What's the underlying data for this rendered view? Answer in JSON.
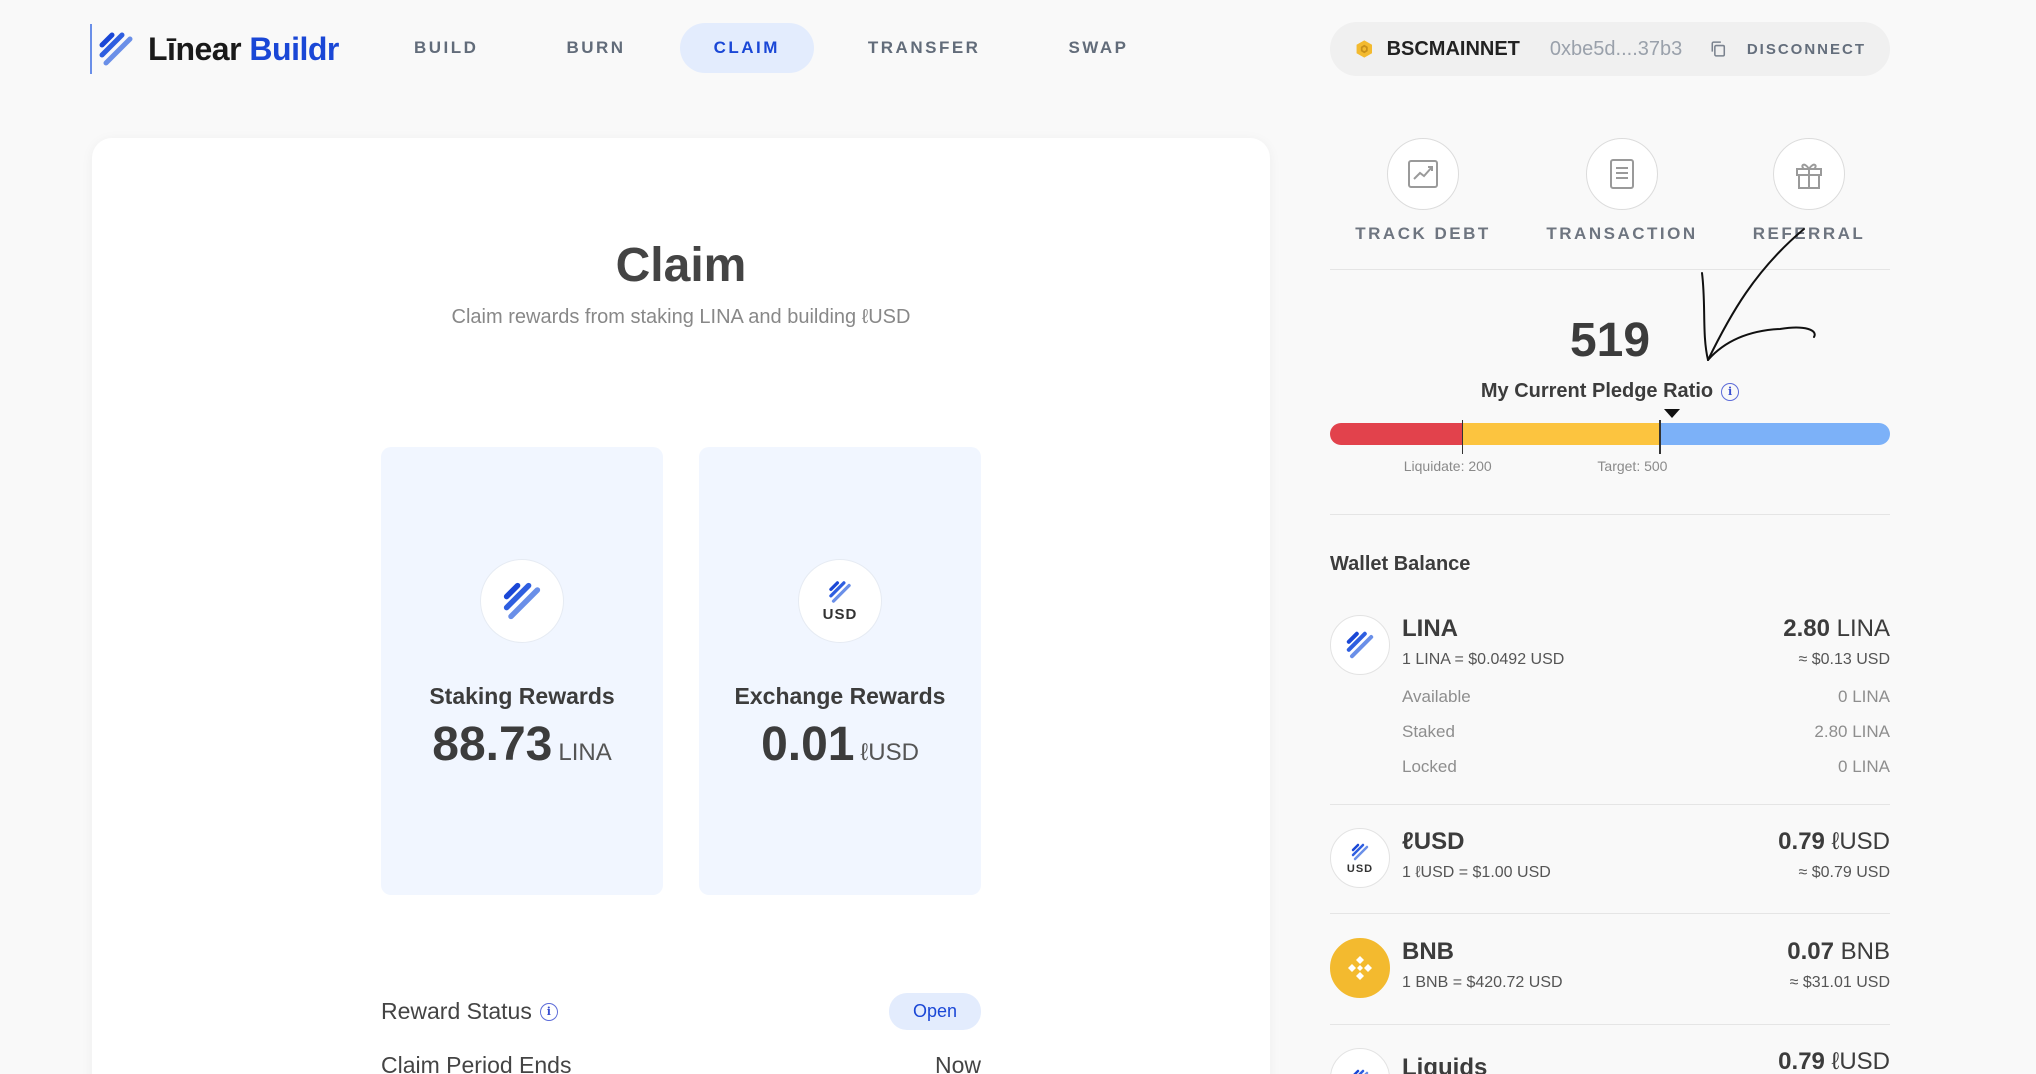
{
  "brand": {
    "word1": "Līnear",
    "word2": "Buildr"
  },
  "nav": [
    {
      "label": "BUILD",
      "active": false
    },
    {
      "label": "BURN",
      "active": false
    },
    {
      "label": "CLAIM",
      "active": true
    },
    {
      "label": "TRANSFER",
      "active": false
    },
    {
      "label": "SWAP",
      "active": false
    }
  ],
  "wallet": {
    "network": "BSCMAINNET",
    "address": "0xbe5d....37b3",
    "disconnect": "DISCONNECT"
  },
  "claim": {
    "title": "Claim",
    "subtitle": "Claim rewards from staking LINA and building ℓUSD",
    "staking": {
      "name": "Staking Rewards",
      "value": "88.73",
      "unit": "LINA"
    },
    "exchange": {
      "name": "Exchange Rewards",
      "value": "0.01",
      "unit": "ℓUSD",
      "icon_text": "USD"
    },
    "reward_status_label": "Reward Status",
    "reward_status_value": "Open",
    "claim_period_label": "Claim Period Ends",
    "claim_period_value": "Now"
  },
  "quick_links": [
    {
      "label": "TRACK DEBT",
      "icon": "chart-icon"
    },
    {
      "label": "TRANSACTION",
      "icon": "document-icon"
    },
    {
      "label": "REFERRAL",
      "icon": "gift-icon"
    }
  ],
  "pledge": {
    "ratio": "519",
    "label": "My Current Pledge Ratio",
    "scale_max": 850,
    "liquidate_value": 200,
    "target_value": 500,
    "current_value": 519,
    "liquidate_caption": "Liquidate: 200",
    "target_caption": "Target: 500",
    "colors": {
      "liquidate": "#e2424c",
      "warning": "#fcc43f",
      "safe": "#7cb1f8"
    }
  },
  "wallet_balance": {
    "title": "Wallet Balance",
    "tokens": [
      {
        "name": "LINA",
        "rate": "1 LINA = $0.0492 USD",
        "balance": "2.80",
        "unit": "LINA",
        "usd": "≈ $0.13 USD",
        "rows": [
          {
            "label": "Available",
            "value": "0 LINA"
          },
          {
            "label": "Staked",
            "value": "2.80 LINA"
          },
          {
            "label": "Locked",
            "value": "0 LINA"
          }
        ]
      },
      {
        "name": "ℓUSD",
        "rate": "1 ℓUSD = $1.00 USD",
        "balance": "0.79",
        "unit": "ℓUSD",
        "usd": "≈ $0.79 USD",
        "icon_text": "USD"
      },
      {
        "name": "BNB",
        "rate": "1 BNB = $420.72 USD",
        "balance": "0.07",
        "unit": "BNB",
        "usd": "≈ $31.01 USD"
      },
      {
        "name": "Liquids",
        "balance": "0.79",
        "unit": "ℓUSD"
      }
    ]
  },
  "accent_color": "#1a47d6"
}
